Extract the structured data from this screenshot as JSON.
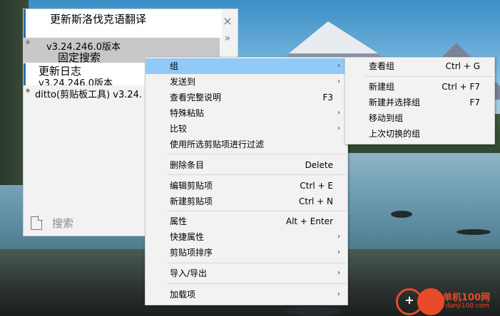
{
  "clips": [
    {
      "title": "更新斯洛伐克语翻译",
      "sub": ""
    },
    {
      "title": "固定搜索",
      "sub": "v3.24.246.0版本"
    },
    {
      "title": "更新日志",
      "sub": "v3.24.246.0版本"
    },
    {
      "title": "ditto(剪贴板工具) v3.24.",
      "sub": ""
    }
  ],
  "window": {
    "close_glyph": "×",
    "more_glyph": "»",
    "search_label": "搜索"
  },
  "menu": {
    "items": [
      {
        "label": "组",
        "shortcut": "",
        "submenu": true
      },
      {
        "label": "发送到",
        "shortcut": "",
        "submenu": true
      },
      {
        "label": "查看完整说明",
        "shortcut": "F3",
        "submenu": false
      },
      {
        "label": "特殊粘贴",
        "shortcut": "",
        "submenu": true
      },
      {
        "label": "比较",
        "shortcut": "",
        "submenu": true
      },
      {
        "label": "使用所选剪贴项进行过滤",
        "shortcut": "",
        "submenu": false
      },
      {
        "label": "删除条目",
        "shortcut": "Delete",
        "submenu": false
      },
      {
        "label": "编辑剪贴项",
        "shortcut": "Ctrl + E",
        "submenu": false
      },
      {
        "label": "新建剪贴项",
        "shortcut": "Ctrl + N",
        "submenu": false
      },
      {
        "label": "属性",
        "shortcut": "Alt + Enter",
        "submenu": false
      },
      {
        "label": "快捷属性",
        "shortcut": "",
        "submenu": true
      },
      {
        "label": "剪贴项排序",
        "shortcut": "",
        "submenu": true
      },
      {
        "label": "导入/导出",
        "shortcut": "",
        "submenu": true
      },
      {
        "label": "加载项",
        "shortcut": "",
        "submenu": true
      }
    ],
    "arrow_glyph": "›"
  },
  "submenu": {
    "items": [
      {
        "label": "查看组",
        "shortcut": "Ctrl + G"
      },
      {
        "label": "新建组",
        "shortcut": "Ctrl + F7"
      },
      {
        "label": "新建并选择组",
        "shortcut": "F7"
      },
      {
        "label": "移动到组",
        "shortcut": ""
      },
      {
        "label": "上次切换的组",
        "shortcut": ""
      }
    ]
  },
  "watermark": {
    "text": "单机100网",
    "sub": "danji100.com",
    "glyph": "+"
  },
  "colors": {
    "highlight": "#91c9f7",
    "accent": "#2b6cb0",
    "watermark": "#e94a2a"
  }
}
